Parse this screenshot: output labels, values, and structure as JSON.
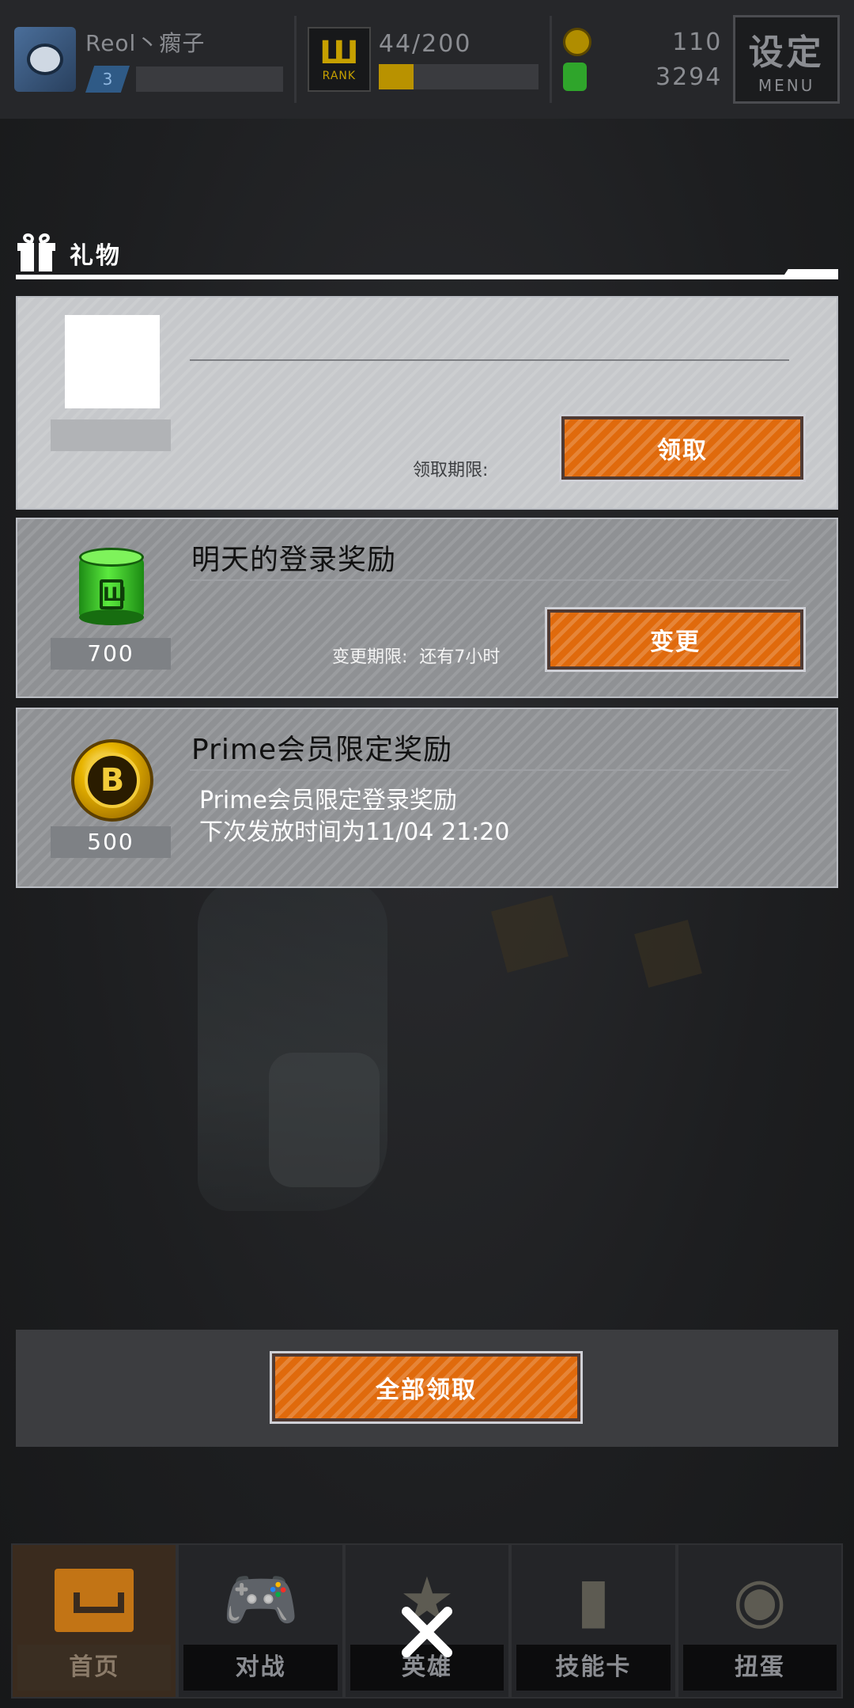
{
  "topbar": {
    "player_name": "Reol丶瘸子",
    "player_level": "3",
    "rank_label": "RANK",
    "rank_count": "44/200",
    "rank_progress": 0.22,
    "coins": "110",
    "cans": "3294",
    "menu_kanji": "设定",
    "menu_en": "MENU"
  },
  "gift": {
    "title": "礼物"
  },
  "cards": [
    {
      "title": "",
      "qty": "",
      "deadline_label": "领取期限:",
      "button": "领取"
    },
    {
      "title": "明天的登录奖励",
      "qty": "700",
      "deadline_label": "变更期限:",
      "deadline_value": "还有7小时",
      "button": "变更"
    },
    {
      "title": "Prime会员限定奖励",
      "qty": "500",
      "desc_line1": "Prime会员限定登录奖励",
      "desc_line2": "下次发放时间为11/04  21:20"
    }
  ],
  "collect_all": "全部领取",
  "nav": [
    {
      "label": "首页",
      "icon": "home-return-icon"
    },
    {
      "label": "对战",
      "icon": "gamepad-icon"
    },
    {
      "label": "英雄",
      "icon": "hero-icon"
    },
    {
      "label": "技能卡",
      "icon": "skill-card-icon"
    },
    {
      "label": "扭蛋",
      "icon": "gacha-icon"
    }
  ],
  "colors": {
    "accent": "#e06a0c",
    "card_light": "#c6c8cb",
    "card_dark": "#8f9194"
  }
}
